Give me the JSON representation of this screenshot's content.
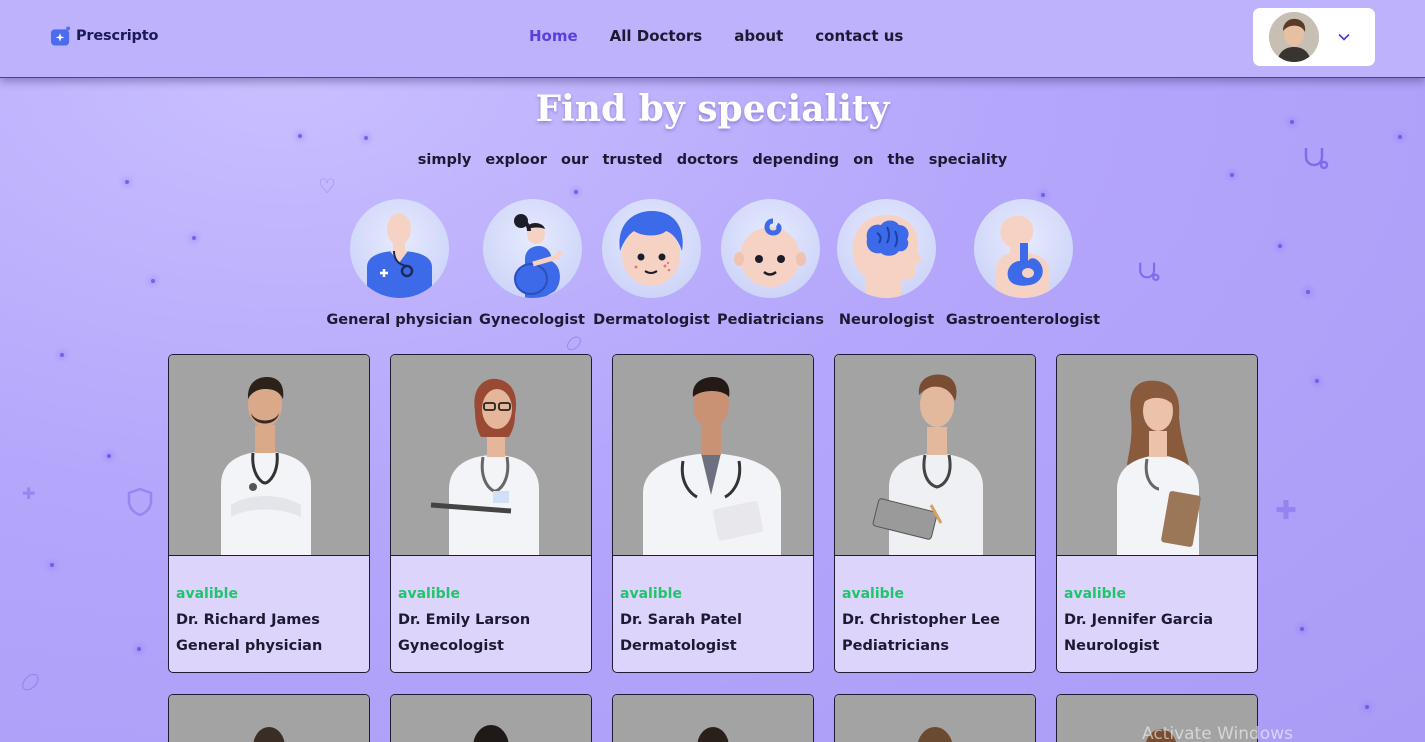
{
  "header": {
    "brand": "Prescripto",
    "nav": [
      {
        "label": "Home",
        "active": true
      },
      {
        "label": "All Doctors",
        "active": false
      },
      {
        "label": "about",
        "active": false
      },
      {
        "label": "contact us",
        "active": false
      }
    ]
  },
  "speciality": {
    "title": "Find by speciality",
    "subtitle": "simply exploor our trusted doctors depending on the speciality",
    "items": [
      {
        "label": "General physician",
        "icon": "general-physician-icon"
      },
      {
        "label": "Gynecologist",
        "icon": "gynecologist-icon"
      },
      {
        "label": "Dermatologist",
        "icon": "dermatologist-icon"
      },
      {
        "label": "Pediatricians",
        "icon": "pediatrician-icon"
      },
      {
        "label": "Neurologist",
        "icon": "neurologist-icon"
      },
      {
        "label": "Gastroenterologist",
        "icon": "gastroenterologist-icon"
      }
    ]
  },
  "doctors": [
    {
      "status": "avalible",
      "name": "Dr. Richard James",
      "speciality": "General physician"
    },
    {
      "status": "avalible",
      "name": "Dr. Emily Larson",
      "speciality": "Gynecologist"
    },
    {
      "status": "avalible",
      "name": "Dr. Sarah Patel",
      "speciality": "Dermatologist"
    },
    {
      "status": "avalible",
      "name": "Dr. Christopher Lee",
      "speciality": "Pediatricians"
    },
    {
      "status": "avalible",
      "name": "Dr. Jennifer Garcia",
      "speciality": "Neurologist"
    }
  ],
  "watermark": "Activate Windows",
  "colors": {
    "accent": "#5a3fe0",
    "available": "#1fc46b",
    "header_bg": "#bdb2fb",
    "card_bg": "#ddd4fc"
  }
}
